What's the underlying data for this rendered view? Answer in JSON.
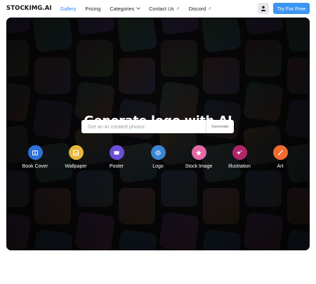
{
  "header": {
    "logo": "STOCKIMG.AI",
    "nav": [
      {
        "label": "Gallery",
        "active": true
      },
      {
        "label": "Pricing"
      },
      {
        "label": "Categories",
        "dropdown": true
      },
      {
        "label": "Contact Us",
        "external": true
      },
      {
        "label": "Discord",
        "external": true
      }
    ],
    "cta_label": "Try For Free",
    "user_icon": "user-icon"
  },
  "hero": {
    "title": "Generate logo with AI",
    "search_placeholder": "Get an AI created photos",
    "generate_label": "Generate"
  },
  "categories": [
    {
      "label": "Book Cover",
      "icon": "book-icon",
      "color": "#2f6fd8"
    },
    {
      "label": "Wallpaper",
      "icon": "wallpaper-icon",
      "color": "#e7b73a"
    },
    {
      "label": "Poster",
      "icon": "poster-icon",
      "color": "#6b4fd6"
    },
    {
      "label": "Logo",
      "icon": "logo-icon",
      "color": "#3d84d4"
    },
    {
      "label": "Stock Image",
      "icon": "star-icon",
      "color": "#e46aa6"
    },
    {
      "label": "Illustration",
      "icon": "sparkles-icon",
      "color": "#b0266a"
    },
    {
      "label": "Art",
      "icon": "brush-icon",
      "color": "#ee6c2d"
    }
  ],
  "colors": {
    "accent": "#3b95f2",
    "active_nav": "#3b82f6",
    "hero_bg": "#0b0b0d"
  }
}
